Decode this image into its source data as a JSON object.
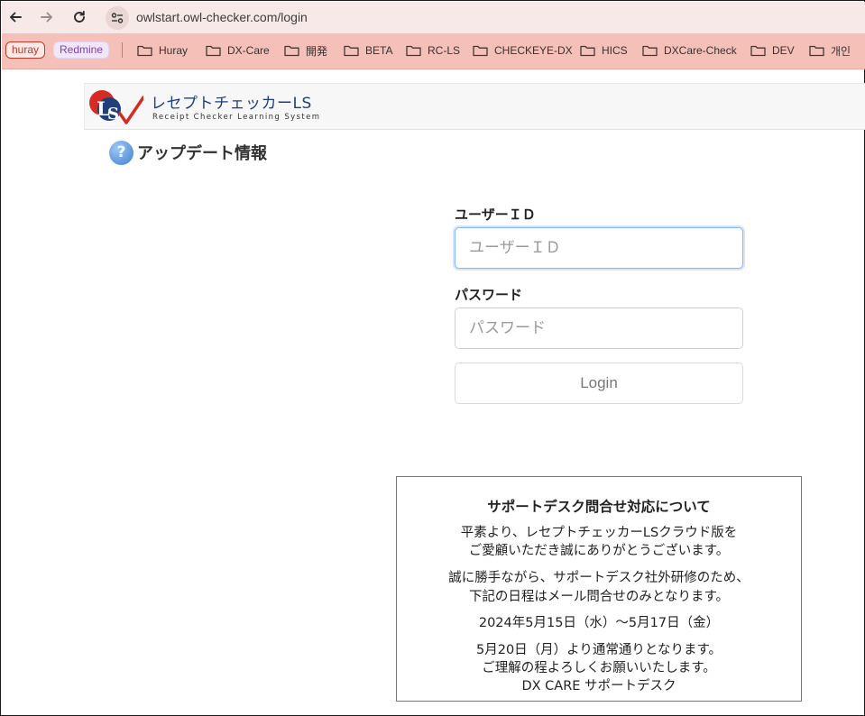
{
  "browser": {
    "url": "owlstart.owl-checker.com/login",
    "nav": {
      "back_icon": "arrow-left-icon",
      "forward_icon": "arrow-right-icon",
      "reload_icon": "reload-icon",
      "site_info_icon": "tune-icon"
    }
  },
  "bookmarks": {
    "chips": [
      "huray",
      "Redmine"
    ],
    "folders": [
      "Huray",
      "DX-Care",
      "開発",
      "BETA",
      "RC-LS",
      "CHECKEYE-DX",
      "HICS",
      "DXCare-Check",
      "DEV",
      "개인"
    ]
  },
  "header": {
    "title": "レセプトチェッカーLS",
    "subtitle": "Receipt Checker Learning System"
  },
  "update": {
    "icon": "question-circle-icon",
    "label": "アップデート情報"
  },
  "login": {
    "userid_label": "ユーザーＩＤ",
    "userid_placeholder": "ユーザーＩＤ",
    "password_label": "パスワード",
    "password_placeholder": "パスワード",
    "login_button": "Login"
  },
  "notice": {
    "title": "サポートデスク問合せ対応について",
    "lines": [
      "平素より、レセプトチェッカーLSクラウド版を",
      "ご愛顧いただき誠にありがとうございます。",
      "誠に勝手ながら、サポートデスク社外研修のため、",
      "下記の日程はメール問合せのみとなります。",
      "2024年5月15日（水）～5月17日（金）",
      "5月20日（月）より通常通りとなります。",
      "ご理解の程よろしくお願いいたします。",
      "DX CARE サポートデスク"
    ]
  },
  "colors": {
    "address_bar": "#f7e9e7",
    "bookmark_bar": "#f5c0b8",
    "brand_blue": "#1f3f7a",
    "brand_red": "#d62b22"
  }
}
